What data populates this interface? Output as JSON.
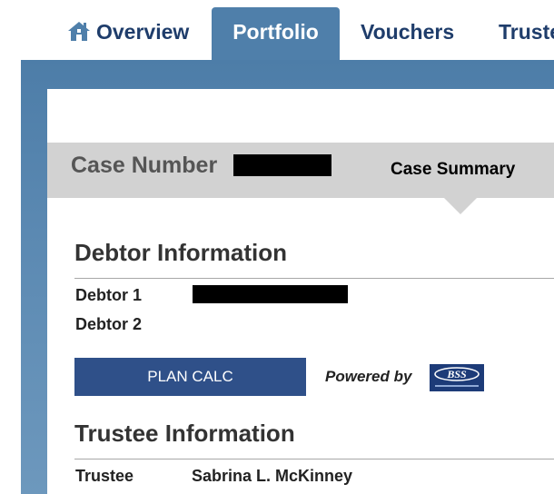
{
  "nav": {
    "tabs": [
      {
        "label": "Overview",
        "icon": "house-icon",
        "active": false
      },
      {
        "label": "Portfolio",
        "active": true
      },
      {
        "label": "Vouchers",
        "active": false
      },
      {
        "label": "Truste",
        "active": false
      }
    ]
  },
  "case": {
    "label": "Case Number",
    "summary_label": "Case Summary"
  },
  "debtor": {
    "title": "Debtor Information",
    "debtor1_label": "Debtor 1",
    "debtor2_label": "Debtor 2"
  },
  "plan_calc": {
    "button_label": "PLAN CALC",
    "powered_by": "Powered by",
    "logo_text": "BSS"
  },
  "trustee": {
    "title": "Trustee Information",
    "label": "Trustee",
    "name": "Sabrina L. McKinney"
  },
  "colors": {
    "frame_blue": "#4d7da8",
    "active_tab": "#4f7faa",
    "button_navy": "#2f5089",
    "nav_text": "#1f3d6b",
    "case_bar": "#d2d2d2"
  }
}
